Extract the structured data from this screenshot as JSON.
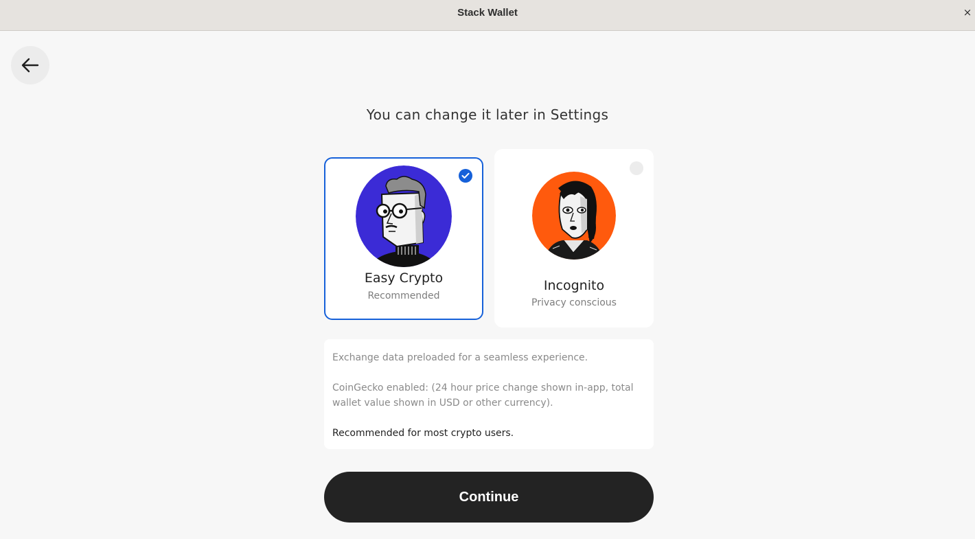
{
  "window": {
    "title": "Stack Wallet",
    "close_label": "×"
  },
  "header": {
    "subtitle": "You can change it later in Settings"
  },
  "options": [
    {
      "title": "Easy Crypto",
      "subtitle": "Recommended",
      "selected": true,
      "avatar_color": "#3b2bd6"
    },
    {
      "title": "Incognito",
      "subtitle": "Privacy conscious",
      "selected": false,
      "avatar_color": "#ff5a0d"
    }
  ],
  "info": {
    "line1": "Exchange data preloaded for a seamless experience.",
    "line2": "CoinGecko enabled: (24 hour price change shown in-app, total wallet value shown in USD or other currency).",
    "line3": "Recommended for most crypto users."
  },
  "actions": {
    "continue_label": "Continue"
  },
  "colors": {
    "accent": "#1560d9",
    "button_bg": "#232323",
    "page_bg": "#f7f7f7"
  }
}
